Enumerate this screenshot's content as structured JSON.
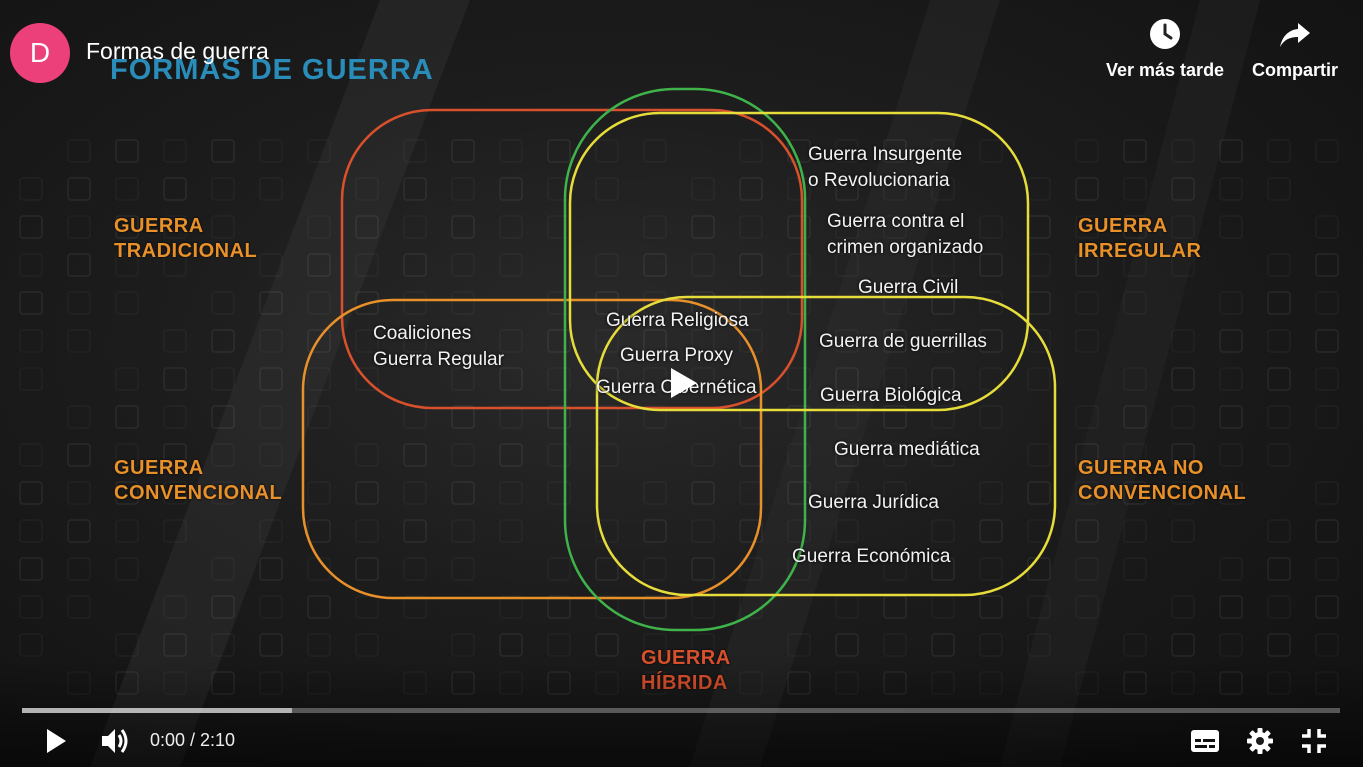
{
  "channel": {
    "avatar_letter": "D",
    "avatar_color": "#ec407a"
  },
  "video": {
    "title": "Formas de guerra"
  },
  "slide": {
    "title": "FORMAS DE GUERRA",
    "categories": {
      "tradicional": "GUERRA\nTRADICIONAL",
      "convencional": "GUERRA\nCONVENCIONAL",
      "irregular": "GUERRA\nIRREGULAR",
      "no_convencional": "GUERRA NO\nCONVENCIONAL",
      "hibrida": "GUERRA\nHÍBRIDA"
    },
    "items": {
      "coaliciones": "Coaliciones\nGuerra Regular",
      "insurgente": "Guerra Insurgente\no Revolucionaria",
      "crimen": "Guerra contra el\ncrimen organizado",
      "civil": "Guerra Civil",
      "religiosa": "Guerra Religiosa",
      "proxy": "Guerra Proxy",
      "cibernetica": "Guerra Cibernética",
      "guerrillas": "Guerra de guerrillas",
      "biologica": "Guerra Biológica",
      "mediatica": "Guerra mediática",
      "juridica": "Guerra Jurídica",
      "economica": "Guerra Económica"
    },
    "colors": {
      "tradicional": "#d9502c",
      "convencional": "#e8902a",
      "irregular": "#e6dc3a",
      "no_convencional": "#e6dc3a",
      "hibrida": "#3fb34a",
      "title": "#2a8cb8"
    }
  },
  "top_actions": {
    "watch_later": {
      "label": "Ver más tarde",
      "icon": "clock-icon"
    },
    "share": {
      "label": "Compartir",
      "icon": "share-arrow-icon"
    }
  },
  "controls": {
    "time_current": "0:00",
    "time_total": "2:10",
    "time_display": "0:00 / 2:10",
    "progress_buffered": 0.205,
    "play_icon": "play-icon",
    "volume_icon": "volume-icon",
    "subtitles_icon": "subtitles-icon",
    "settings_icon": "gear-icon",
    "exit_fullscreen_icon": "exit-fullscreen-icon"
  }
}
